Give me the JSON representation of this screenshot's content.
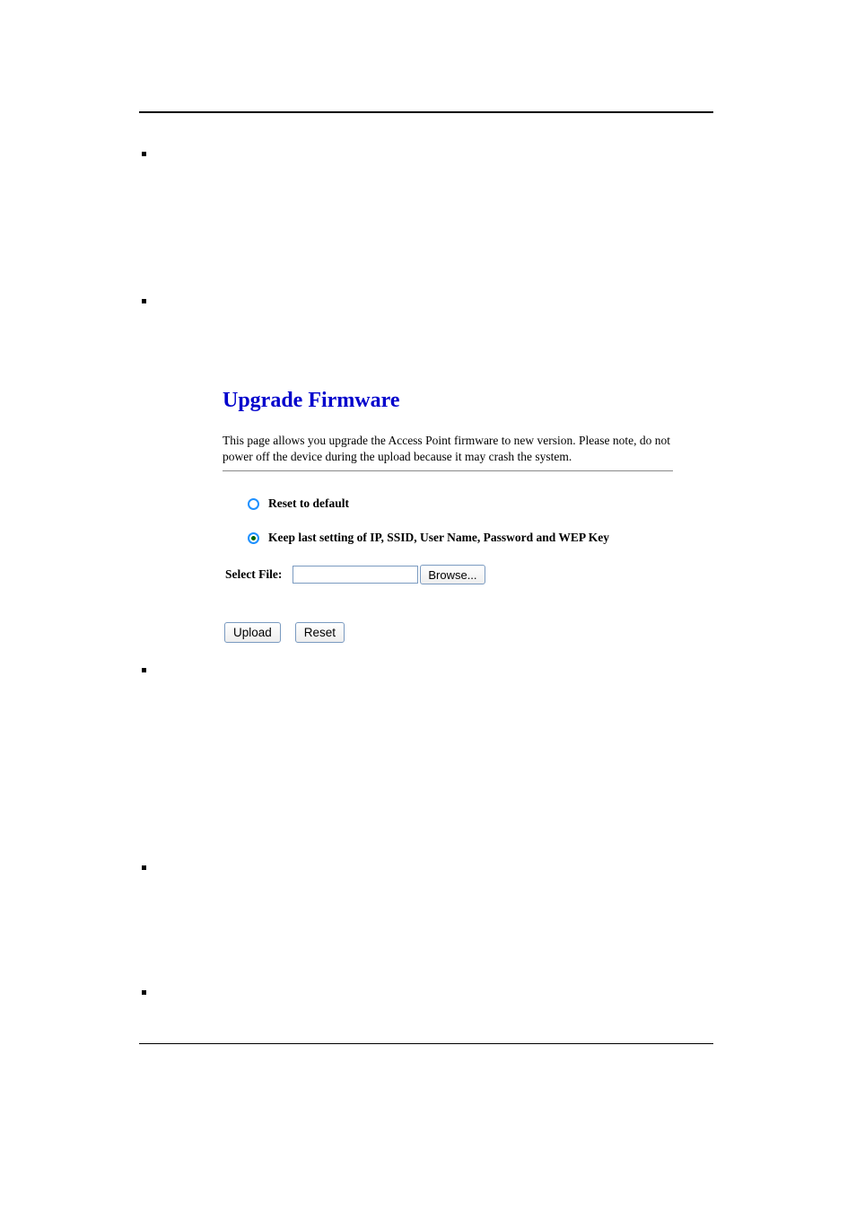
{
  "panel": {
    "title": "Upgrade Firmware",
    "description": "This page allows you upgrade the Access Point firmware to new version. Please note, do not power off the device during the upload because it may crash the system.",
    "options": {
      "reset_default": "Reset to default",
      "keep_settings": "Keep last setting of IP, SSID, User Name, Password and WEP Key"
    },
    "file_label": "Select File:",
    "browse_button": "Browse...",
    "upload_button": "Upload",
    "reset_button": "Reset"
  }
}
